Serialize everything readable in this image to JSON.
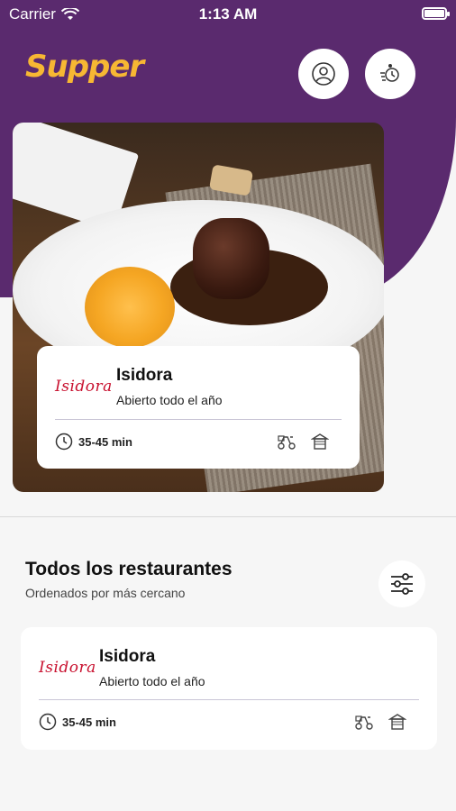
{
  "status_bar": {
    "carrier": "Carrier",
    "time": "1:13 AM"
  },
  "app": {
    "logo": "Supper"
  },
  "header_actions": {
    "profile_icon": "user-circle-icon",
    "order_icon": "scooter-clock-icon"
  },
  "featured": {
    "logo_text": "Isidora",
    "name": "Isidora",
    "status": "Abierto todo el año",
    "delivery_time": "35-45 min",
    "service_icons": [
      "delivery-scooter-icon",
      "pickup-store-icon"
    ]
  },
  "all_restaurants": {
    "title": "Todos los restaurantes",
    "subtitle": "Ordenados por más cercano",
    "filter_icon": "sliders-icon",
    "items": [
      {
        "logo_text": "Isidora",
        "name": "Isidora",
        "status": "Abierto todo el año",
        "delivery_time": "35-45 min"
      }
    ]
  },
  "colors": {
    "brand_purple": "#5a2a6e",
    "logo_yellow": "#f7b733",
    "restaurant_red": "#c8102e"
  }
}
